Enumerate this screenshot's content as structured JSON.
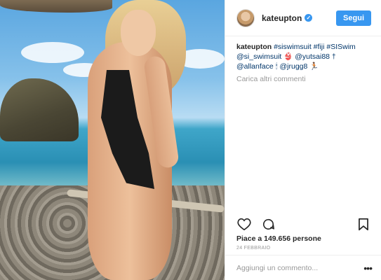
{
  "post": {
    "username": "kateupton",
    "follow_label": "Segui",
    "caption_user": "kateupton",
    "caption_text": "#siswimsuit #fiji #SISwim @si_swimsuit 👙 @yutsai88 † @allanface 🕯 @jrugg8 🏃🏽",
    "load_more": "Carica altri commenti",
    "likes": "Piace a 149.656 persone",
    "date": "24 FEBBRAIO",
    "comment_placeholder": "Aggiungi un commento..."
  },
  "icons": {
    "verified": "verified-badge-icon",
    "like": "heart-icon",
    "comment": "comment-bubble-icon",
    "save": "bookmark-icon",
    "more": "more-options-icon"
  },
  "colors": {
    "accent": "#3897f0",
    "link": "#003569",
    "muted": "#999999"
  }
}
